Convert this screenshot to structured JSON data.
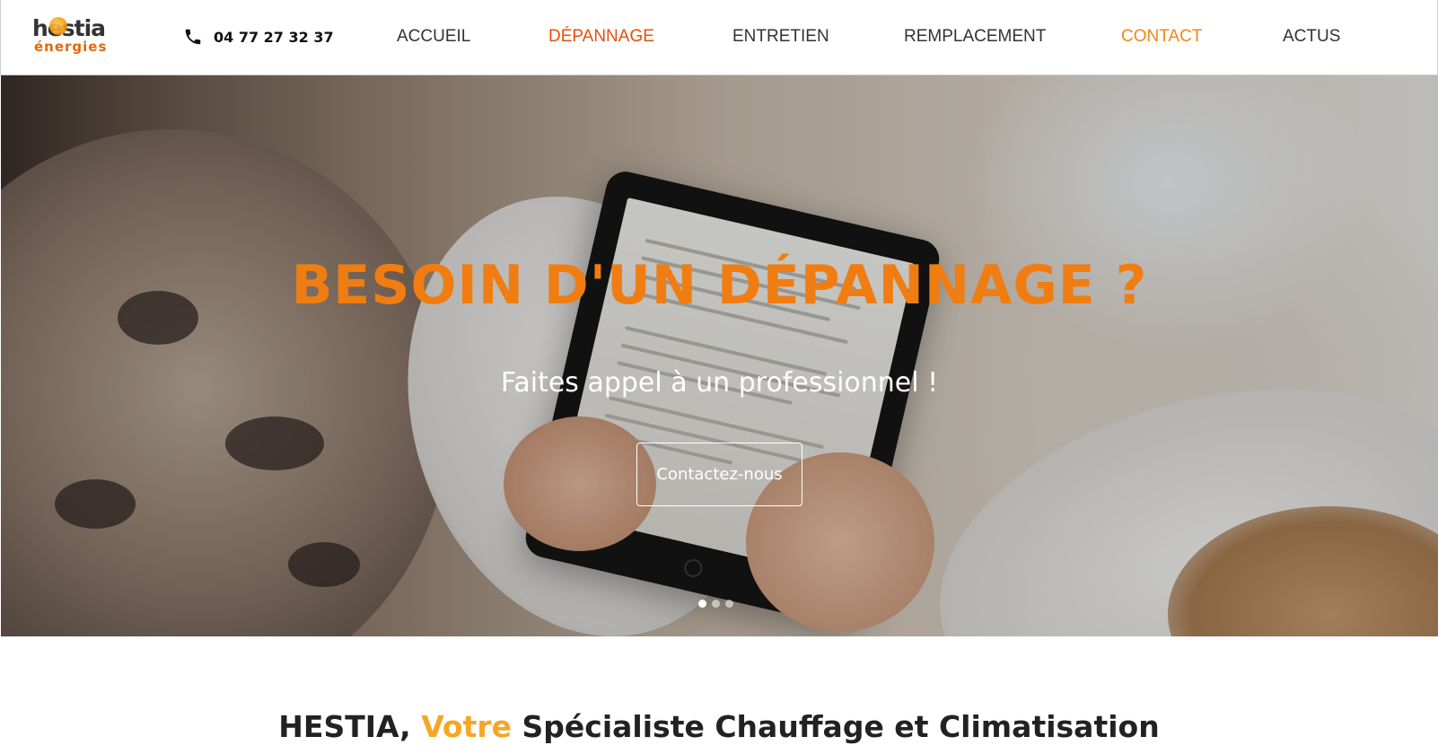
{
  "header": {
    "logo": {
      "line1": "hestia",
      "line2": "énergies"
    },
    "phone": "04 77 27 32 37",
    "nav": [
      {
        "label": "ACCUEIL",
        "color": "#333333"
      },
      {
        "label": "DÉPANNAGE",
        "color": "#e2500c"
      },
      {
        "label": "ENTRETIEN",
        "color": "#333333"
      },
      {
        "label": "REMPLACEMENT",
        "color": "#333333"
      },
      {
        "label": "CONTACT",
        "color": "#f0861a"
      },
      {
        "label": "ACTUS",
        "color": "#333333"
      }
    ]
  },
  "hero": {
    "title": "BESOIN D'UN DÉPANNAGE ?",
    "subtitle": "Faites appel à un professionnel !",
    "button": "Contactez-nous",
    "slides": 3,
    "active_slide": 1
  },
  "intro": {
    "title_part1": "HESTIA, ",
    "title_accent": "Votre",
    "title_part2": " Spécialiste Chauffage et Climatisation"
  },
  "colors": {
    "accent_orange": "#f07d12",
    "nav_active": "#e2500c",
    "contact": "#f0861a",
    "votre": "#f5a623"
  },
  "icons": {
    "phone": "phone-icon",
    "logo_sun": "sun-icon"
  }
}
